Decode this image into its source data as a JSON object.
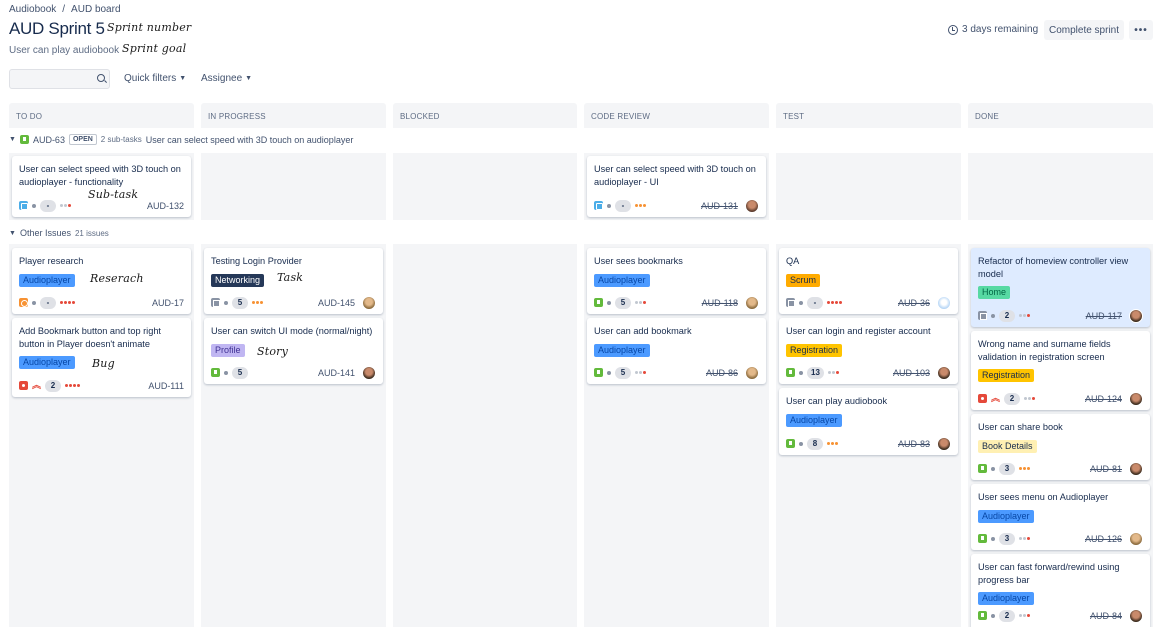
{
  "breadcrumb": {
    "project": "Audiobook",
    "separator": "/",
    "board": "AUD board"
  },
  "sprint": {
    "title": "AUD Sprint 5",
    "goal": "User can play audiobook"
  },
  "handwriting": {
    "sprint_number": "Sprint number",
    "sprint_goal": "Sprint goal",
    "subtask": "Sub-task",
    "research": "Reserach",
    "task": "Task",
    "bug": "Bug",
    "story": "Story"
  },
  "header_actions": {
    "remaining": "3 days remaining",
    "complete_sprint": "Complete sprint",
    "more": "•••"
  },
  "filters": {
    "search_value": "",
    "quick_filters": "Quick filters",
    "assignee": "Assignee"
  },
  "columns": [
    "TO DO",
    "IN PROGRESS",
    "BLOCKED",
    "CODE REVIEW",
    "TEST",
    "DONE"
  ],
  "swimlane_parent": {
    "key": "AUD-63",
    "status": "OPEN",
    "subtasks": "2 sub-tasks",
    "summary": "User can select speed with 3D touch on audioplayer"
  },
  "swimlane_other": {
    "label": "Other Issues",
    "count": "21 issues"
  },
  "colors": {
    "story": "#63ba3c",
    "subtask": "#4bade8",
    "bug": "#e5493a",
    "research": "#f79233",
    "column_bg": "#f4f5f7"
  },
  "cards": {
    "c1": {
      "summary": "User can select speed with 3D touch on audioplayer - functionality",
      "estimate": "-",
      "key": "AUD-132"
    },
    "c2": {
      "summary": "User can select speed with 3D touch on audioplayer - UI",
      "estimate": "-",
      "key": "AUD-131"
    },
    "c3": {
      "summary": "Player research",
      "epic": "Audioplayer",
      "estimate": "-",
      "key": "AUD-17"
    },
    "c4": {
      "summary": "Add Bookmark button and top right button in Player doesn't animate",
      "epic": "Audioplayer",
      "estimate": "2",
      "key": "AUD-111"
    },
    "c5": {
      "summary": "Testing Login Provider",
      "epic": "Networking",
      "estimate": "5",
      "key": "AUD-145"
    },
    "c6": {
      "summary": "User can switch UI mode (normal/night)",
      "epic": "Profile",
      "estimate": "5",
      "key": "AUD-141"
    },
    "c7": {
      "summary": "User sees bookmarks",
      "epic": "Audioplayer",
      "estimate": "5",
      "key": "AUD-118"
    },
    "c8": {
      "summary": "User can add bookmark",
      "epic": "Audioplayer",
      "estimate": "5",
      "key": "AUD-86"
    },
    "c9": {
      "summary": "QA",
      "epic": "Scrum",
      "estimate": "-",
      "key": "AUD-36"
    },
    "c10": {
      "summary": "User can login and register account",
      "epic": "Registration",
      "estimate": "13",
      "key": "AUD-103"
    },
    "c11": {
      "summary": "User can play audiobook",
      "epic": "Audioplayer",
      "estimate": "8",
      "key": "AUD-83"
    },
    "c12": {
      "summary": "Refactor of homeview controller view model",
      "epic": "Home",
      "estimate": "2",
      "key": "AUD-117"
    },
    "c13": {
      "summary": "Wrong name and surname fields validation in registration screen",
      "epic": "Registration",
      "estimate": "2",
      "key": "AUD-124"
    },
    "c14": {
      "summary": "User can share book",
      "epic": "Book Details",
      "estimate": "3",
      "key": "AUD-81"
    },
    "c15": {
      "summary": "User sees menu on Audioplayer",
      "epic": "Audioplayer",
      "estimate": "3",
      "key": "AUD-126"
    },
    "c16": {
      "summary": "User can fast forward/rewind using progress bar",
      "epic": "Audioplayer",
      "estimate": "2",
      "key": "AUD-84"
    }
  }
}
